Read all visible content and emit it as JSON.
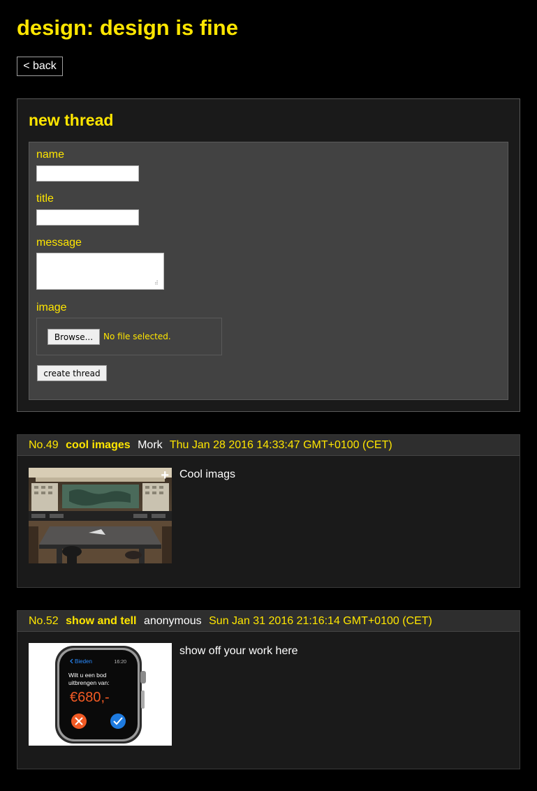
{
  "page": {
    "title": "design: design is fine"
  },
  "nav": {
    "back_label": "< back"
  },
  "new_thread": {
    "heading": "new thread",
    "fields": {
      "name_label": "name",
      "title_label": "title",
      "message_label": "message",
      "image_label": "image"
    },
    "name_value": "",
    "title_value": "",
    "message_value": "",
    "browse_label": "Browse...",
    "file_status": "No file selected.",
    "submit_label": "create thread"
  },
  "threads": [
    {
      "number": "No.49",
      "title": "cool images",
      "author": "Mork",
      "date": "Thu Jan 28 2016 14:33:47 GMT+0100 (CET)",
      "message": "Cool imags",
      "expand_icon": "+"
    },
    {
      "number": "No.52",
      "title": "show and tell",
      "author": "anonymous",
      "date": "Sun Jan 31 2016 21:16:14 GMT+0100 (CET)",
      "message": "show off your work here",
      "watch": {
        "back_label": "Bieden",
        "time": "16:20",
        "question": "Wilt u een bod uitbrengen van:",
        "amount": "€680,-"
      }
    }
  ],
  "colors": {
    "accent": "#ffe600",
    "background": "#000000",
    "panel": "#1a1a1a",
    "form_bg": "#424242",
    "decline": "#f15a24",
    "confirm": "#1e7be0"
  }
}
